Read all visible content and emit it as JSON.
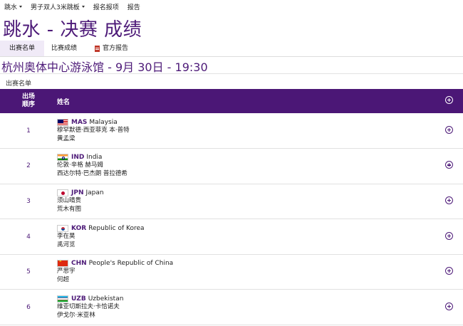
{
  "nav": {
    "items": [
      {
        "label": "跳水",
        "dropdown": true
      },
      {
        "label": "男子双人3米跳板",
        "dropdown": true
      },
      {
        "label": "报名报项",
        "dropdown": false
      },
      {
        "label": "报告",
        "dropdown": false
      }
    ]
  },
  "page_title": "跳水 - 决赛 成绩",
  "tabs": [
    {
      "label": "出赛名单",
      "active": true
    },
    {
      "label": "比赛成绩",
      "active": false
    },
    {
      "label": "官方报告",
      "active": false
    }
  ],
  "venue": "杭州奥体中心游泳馆 - 9月 30日 - 19:30",
  "section_title": "出赛名单",
  "table": {
    "header_order": "出场\n顺序",
    "header_order_line1": "出场",
    "header_order_line2": "顺序",
    "header_name": "姓名",
    "rows": [
      {
        "order": "1",
        "code": "MAS",
        "country": "Malaysia",
        "flag": "mas",
        "athlete1": "穆罕默德·西亚菲克 本·普特",
        "athlete2": "黄孟梁"
      },
      {
        "order": "2",
        "code": "IND",
        "country": "India",
        "flag": "ind",
        "athlete1": "伦敦·辛格 赫马姆",
        "athlete2": "西达尔特·巴杰朗 普拉德希"
      },
      {
        "order": "3",
        "code": "JPN",
        "country": "Japan",
        "flag": "jpn",
        "athlete1": "须山晴贵",
        "athlete2": "荒木有图"
      },
      {
        "order": "4",
        "code": "KOR",
        "country": "Republic of Korea",
        "flag": "kor",
        "athlete1": "李在昊",
        "athlete2": "禹河览"
      },
      {
        "order": "5",
        "code": "CHN",
        "country": "People's Republic of China",
        "flag": "chn",
        "athlete1": "严思宇",
        "athlete2": "何超"
      },
      {
        "order": "6",
        "code": "UZB",
        "country": "Uzbekistan",
        "flag": "uzb",
        "athlete1": "维亚切斯拉夫·卡恰诺夫",
        "athlete2": "伊戈尔·米亚林"
      }
    ]
  },
  "colors": {
    "brand_purple": "#4b1776",
    "title_purple": "#4d1a78"
  }
}
